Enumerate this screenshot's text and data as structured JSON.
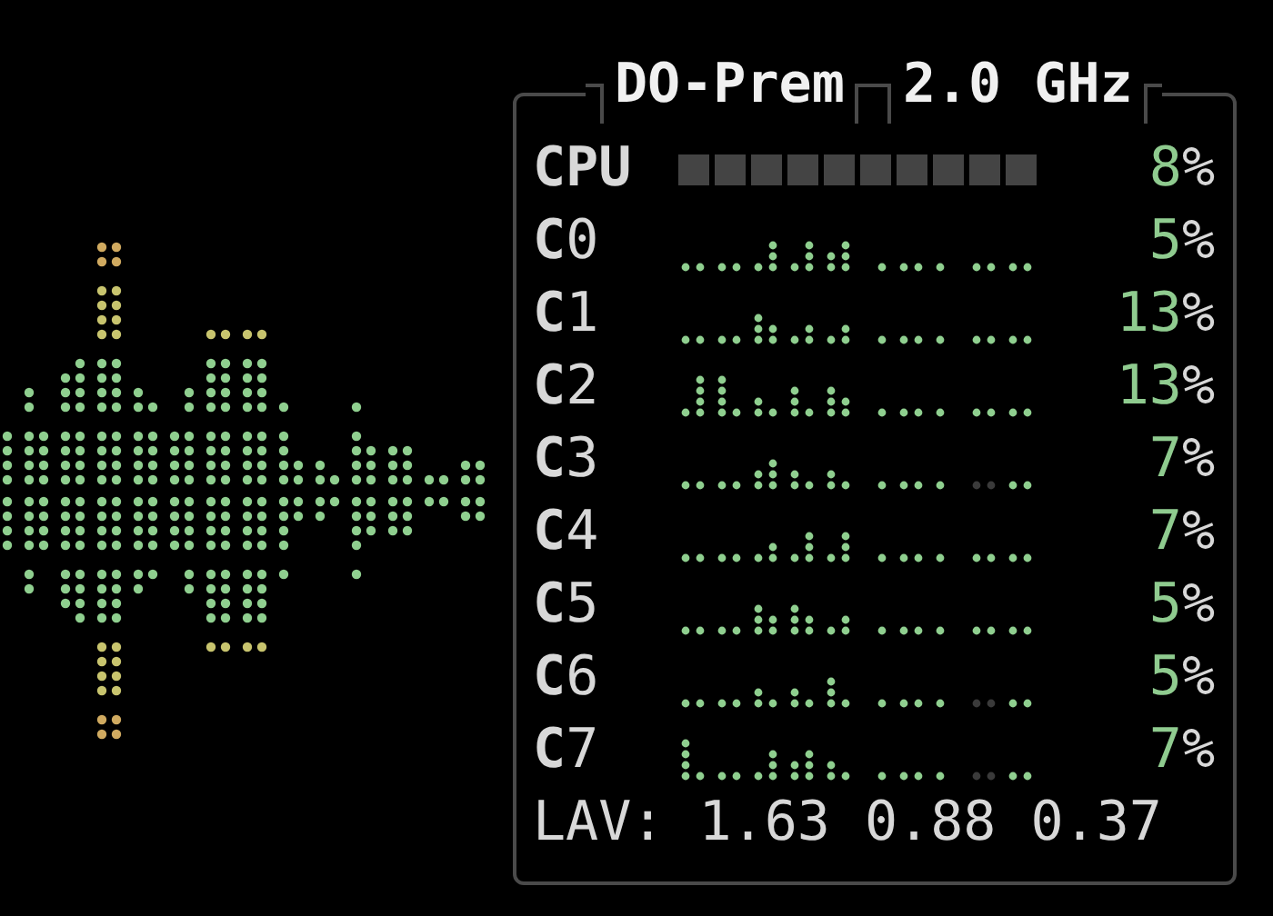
{
  "title": {
    "host": "DO-Prem",
    "clock": "2.0 GHz"
  },
  "cpu": {
    "label": "CPU",
    "percent": "8",
    "unit": "%"
  },
  "cores": [
    {
      "label": "**C**0",
      "percent": "5",
      "unit": "%"
    },
    {
      "label": "**C**1",
      "percent": "13",
      "unit": "%"
    },
    {
      "label": "**C**2",
      "percent": "13",
      "unit": "%"
    },
    {
      "label": "**C**3",
      "percent": "7",
      "unit": "%"
    },
    {
      "label": "**C**4",
      "percent": "7",
      "unit": "%"
    },
    {
      "label": "**C**5",
      "percent": "5",
      "unit": "%"
    },
    {
      "label": "**C**6",
      "percent": "5",
      "unit": "%"
    },
    {
      "label": "**C**7",
      "percent": "7",
      "unit": "%"
    }
  ],
  "load": {
    "label": "LAV:",
    "values": [
      "1.63",
      "0.88",
      "0.37"
    ]
  }
}
